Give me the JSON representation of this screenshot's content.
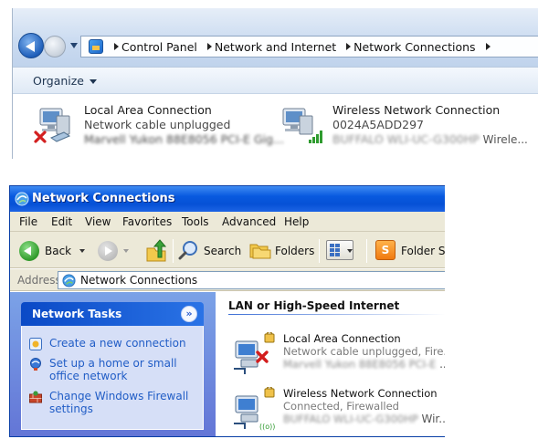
{
  "win7": {
    "breadcrumb": [
      "Control Panel",
      "Network and Internet",
      "Network Connections"
    ],
    "toolbar": {
      "organize_label": "Organize"
    },
    "connections": [
      {
        "name": "Local Area Connection",
        "status": "Network cable unplugged",
        "adapter_blurred": "Marvell Yukon 88E8056 PCI-E Gig...",
        "icon": "wired-network-disconnected-icon"
      },
      {
        "name": "Wireless Network Connection",
        "status": "0024A5ADD297",
        "adapter_blurred": "BUFFALO WLI-UC-G300HP",
        "adapter_tail": "Wirele...",
        "icon": "wireless-network-signal-icon"
      }
    ]
  },
  "xp": {
    "title": "Network Connections",
    "menu": [
      "File",
      "Edit",
      "View",
      "Favorites",
      "Tools",
      "Advanced",
      "Help"
    ],
    "toolbar": {
      "back_label": "Back",
      "search_label": "Search",
      "folders_label": "Folders",
      "folder_sync_label": "Folder Sy"
    },
    "address": {
      "label": "Address",
      "value": "Network Connections"
    },
    "tasks": {
      "title": "Network Tasks",
      "collapse_glyph": "»",
      "items": [
        {
          "label": "Create a new connection",
          "icon": "new-connection-icon"
        },
        {
          "label": "Set up a home or small office network",
          "icon": "home-network-icon"
        },
        {
          "label": "Change Windows Firewall settings",
          "icon": "firewall-icon"
        }
      ]
    },
    "group_title": "LAN or High-Speed Internet",
    "connections": [
      {
        "name": "Local Area Connection",
        "status": "Network cable unplugged, Fire...",
        "adapter_blurred": "Marvell Yukon 88E8056 PCI-E",
        "adapter_tail": "...",
        "icon": "lan-disconnected-firewall-icon"
      },
      {
        "name": "Wireless Network Connection",
        "status": "Connected, Firewalled",
        "adapter_blurred": "BUFFALO WLI-UC-G300HP",
        "adapter_tail": "Wir...",
        "icon": "wireless-connected-firewall-icon"
      }
    ]
  },
  "colors": {
    "xp_title_blue": "#0651d6",
    "xp_task_link": "#215dc6",
    "win7_addr_bg": "#c9daf0"
  }
}
